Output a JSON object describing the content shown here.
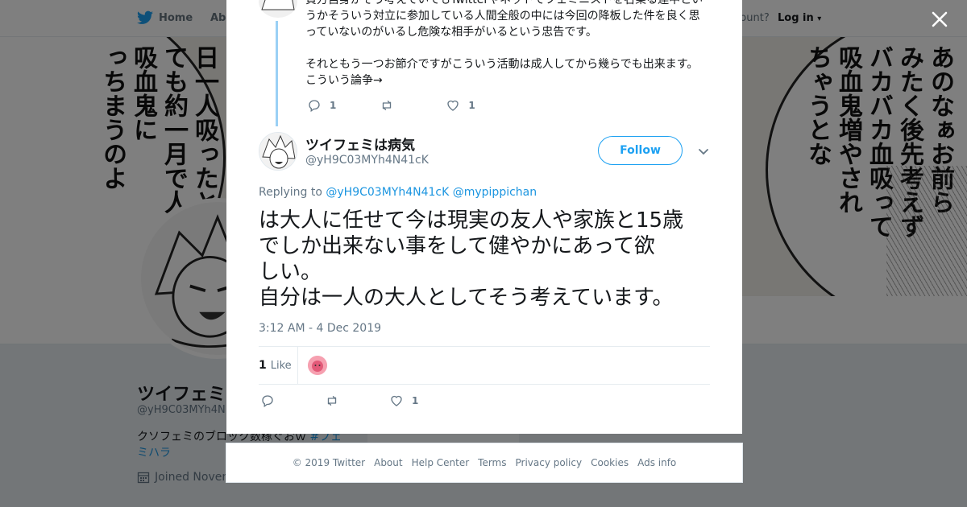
{
  "nav": {
    "home": "Home",
    "about": "Abo",
    "account_prompt": "ccount?",
    "login": "Log in"
  },
  "banner": {
    "left_text": "日一人吸ったとても約一月で人まっちまうのよ 吸血鬼に",
    "left_cols": [
      "日一人吸ったと",
      "ても約一月で人",
      "吸血鬼に",
      "っちまうのよ"
    ],
    "right_cols": [
      "あのなぁお前ら",
      "みたく後先考えず",
      "バカバカ血吸って",
      "吸血鬼増やされ",
      "ちゃうとな"
    ]
  },
  "profile": {
    "name": "ツイフェミ",
    "handle": "@yH9C03MYh4N",
    "bio_text": "クソフェミのブロック数稼ぐおｗ",
    "bio_tag": "#フェミハラ",
    "joined": "Joined Novem"
  },
  "previous_tweet": {
    "line1": "貴方自身がそう考えていてもTwitterやネットでフェミニストを名乗る連中とい",
    "line2": "うかそういう対立に参加している人間全般の中には今回の降板した件を良く思",
    "line3": "っていないのがいるし危険な相手がいるという忠告です。",
    "line4": "それともう一つお節介ですがこういう活動は成人してから幾らでも出来ます。",
    "line5": "こういう論争→",
    "reply_count": "1",
    "retweet_count": "",
    "like_count": "1"
  },
  "tweet": {
    "name": "ツイフェミは病気",
    "handle": "@yH9C03MYh4N41cK",
    "follow_label": "Follow",
    "replying_to_label": "Replying to",
    "replying_to_1": "@yH9C03MYh4N41cK",
    "replying_to_2": "@mypippichan",
    "text_line1": "は大人に任せて今は現実の友人や家族と15歳",
    "text_line2": "でしか出来ない事をして健やかにあって欲",
    "text_line3": "しい。",
    "text_line4": "自分は一人の大人としてそう考えています。",
    "timestamp": "3:12 AM - 4 Dec 2019",
    "likes_count": "1",
    "likes_label": "Like",
    "reply_count": "",
    "retweet_count": "",
    "like_count": "1"
  },
  "footer": {
    "copyright": "© 2019 Twitter",
    "about": "About",
    "help": "Help Center",
    "terms": "Terms",
    "privacy": "Privacy policy",
    "cookies": "Cookies",
    "ads": "Ads info"
  },
  "colors": {
    "accent": "#1da1f2",
    "link": "#1b95e0",
    "muted": "#657786",
    "thread_line": "#9ad0f5"
  },
  "icons": [
    "twitter-bird-icon",
    "close-icon",
    "reply-icon",
    "retweet-icon",
    "heart-icon",
    "chevron-down-icon",
    "calendar-icon"
  ]
}
